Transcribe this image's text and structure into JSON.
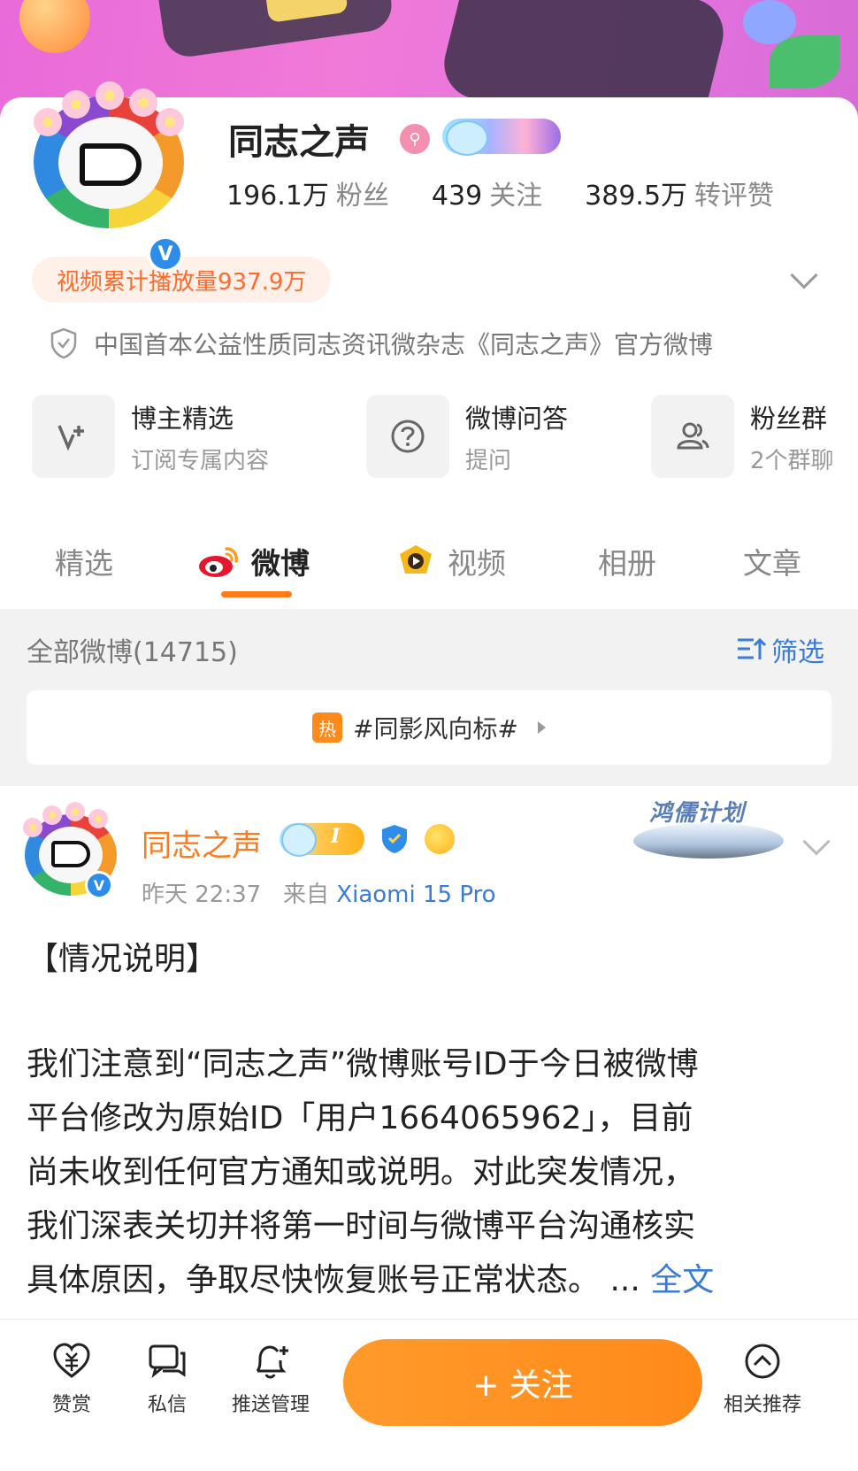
{
  "profile": {
    "name": "同志之声",
    "stats": [
      {
        "value": "196.1万",
        "label": "粉丝"
      },
      {
        "value": "439",
        "label": "关注"
      },
      {
        "value": "389.5万",
        "label": "转评赞"
      }
    ],
    "video_plays": "视频累计播放量937.9万",
    "bio": "中国首本公益性质同志资讯微杂志《同志之声》官方微博"
  },
  "quick_cards": [
    {
      "title": "博主精选",
      "sub": "订阅专属内容",
      "icon": "v-plus-icon"
    },
    {
      "title": "微博问答",
      "sub": "提问",
      "icon": "question-icon"
    },
    {
      "title": "粉丝群",
      "sub": "2个群聊",
      "icon": "group-icon"
    }
  ],
  "tabs": [
    {
      "label": "精选",
      "active": false
    },
    {
      "label": "微博",
      "active": true
    },
    {
      "label": "视频",
      "active": false
    },
    {
      "label": "相册",
      "active": false
    },
    {
      "label": "文章",
      "active": false
    }
  ],
  "feed": {
    "all_label": "全部微博(14715)",
    "filter_label": "筛选",
    "topic_tag": "热",
    "topic": "#同影风向标#"
  },
  "post": {
    "author": "同志之声",
    "badge_level": "I",
    "plan_badge": "鸿儒计划",
    "time": "昨天 22:37",
    "source_prefix": "来自",
    "source": "Xiaomi 15 Pro",
    "heading": "【情况说明】",
    "body_lines": [
      "我们注意到“同志之声”微博账号ID于今日被微博",
      "平台修改为原始ID「用户1664065962」，目前",
      "尚未收到任何官方通知或说明。对此突发情况，",
      "我们深表关切并将第一时间与微博平台沟通核实",
      "具体原因，争取尽快恢复账号正常状态。 ..."
    ],
    "full_text": "全文"
  },
  "bottom_bar": {
    "reward": "赞赏",
    "message": "私信",
    "push": "推送管理",
    "follow": "+ 关注",
    "related": "相关推荐"
  },
  "colors": {
    "accent_orange": "#ff7a1a",
    "link_blue": "#3a7bd5",
    "verified_blue": "#2e8de8"
  }
}
